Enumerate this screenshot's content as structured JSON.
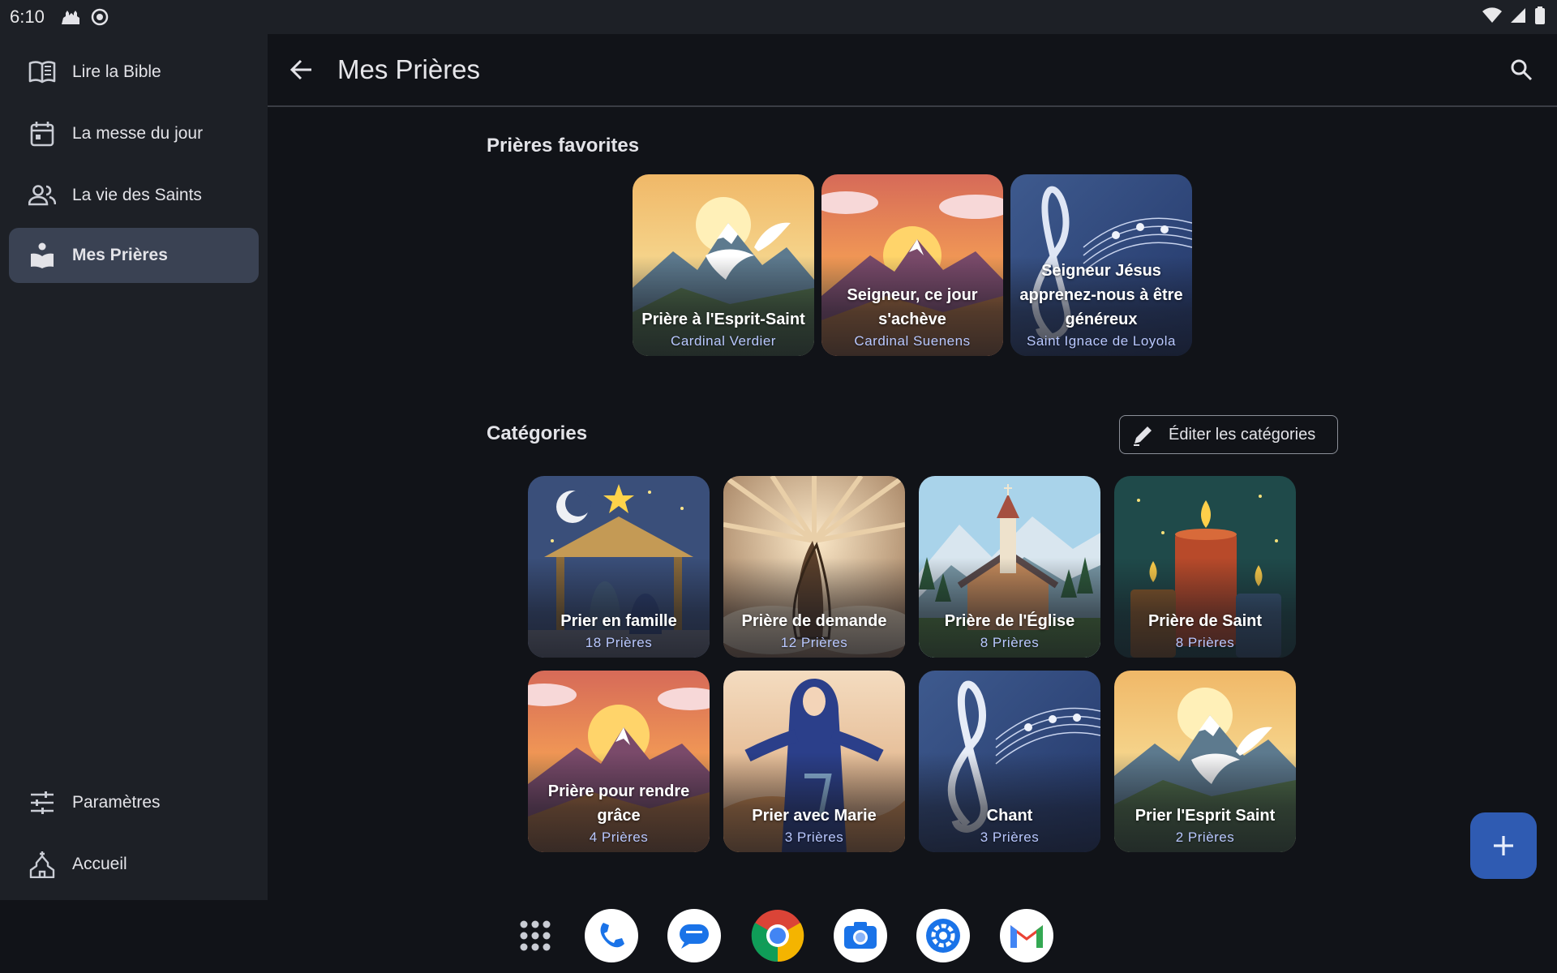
{
  "status_bar": {
    "time": "6:10"
  },
  "drawer": {
    "items": [
      {
        "label": "Lire la Bible",
        "icon": "book-open-icon"
      },
      {
        "label": "La messe du jour",
        "icon": "calendar-icon"
      },
      {
        "label": "La vie des Saints",
        "icon": "people-icon"
      },
      {
        "label": "Mes Prières",
        "icon": "prayer-book-icon",
        "active": true
      }
    ],
    "bottom_items": [
      {
        "label": "Paramètres",
        "icon": "sliders-icon"
      },
      {
        "label": "Accueil",
        "icon": "church-icon"
      }
    ]
  },
  "appbar": {
    "title": "Mes Prières"
  },
  "favorites": {
    "title": "Prières favorites",
    "items": [
      {
        "title": "Prière à l'Esprit-Saint",
        "subtitle": "Cardinal Verdier",
        "art": "dove-mountain"
      },
      {
        "title": "Seigneur, ce jour s'achève",
        "subtitle": "Cardinal Suenens",
        "art": "sunset-mountain"
      },
      {
        "title": "Seigneur Jésus apprenez-nous à être généreux",
        "subtitle": "Saint Ignace de Loyola",
        "art": "music-clef"
      }
    ]
  },
  "categories": {
    "title": "Catégories",
    "edit_label": "Éditer les catégories",
    "items": [
      {
        "title": "Prier en famille",
        "subtitle": "18 Prières",
        "art": "nativity"
      },
      {
        "title": "Prière de demande",
        "subtitle": "12 Prières",
        "art": "praying-hands"
      },
      {
        "title": "Prière de l'Église",
        "subtitle": "8 Prières",
        "art": "church"
      },
      {
        "title": "Prière de Saint",
        "subtitle": "8 Prières",
        "art": "candles"
      },
      {
        "title": "Prière pour rendre grâce",
        "subtitle": "4 Prières",
        "art": "sunset-mountain"
      },
      {
        "title": "Prier avec Marie",
        "subtitle": "3 Prières",
        "art": "mary"
      },
      {
        "title": "Chant",
        "subtitle": "3 Prières",
        "art": "music-clef"
      },
      {
        "title": "Prier l'Esprit Saint",
        "subtitle": "2 Prières",
        "art": "dove-mountain"
      }
    ]
  },
  "fab": {
    "icon": "plus-icon"
  },
  "dock": [
    {
      "name": "app-drawer-icon"
    },
    {
      "name": "phone-icon"
    },
    {
      "name": "messages-icon"
    },
    {
      "name": "chrome-icon"
    },
    {
      "name": "camera-icon"
    },
    {
      "name": "settings-icon"
    },
    {
      "name": "gmail-icon"
    }
  ],
  "colors": {
    "accent": "#2f5bb2",
    "active_nav": "#3a4253",
    "subtitle": "#b9c8ff",
    "background": "#111318",
    "surface": "#1d2026"
  }
}
